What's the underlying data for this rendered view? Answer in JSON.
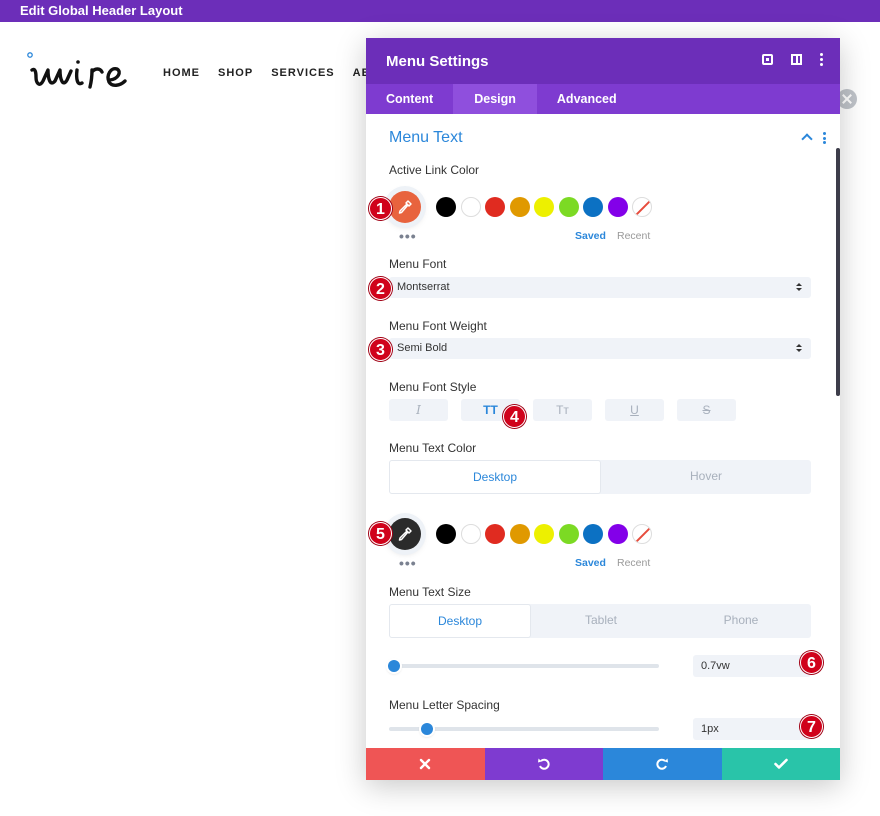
{
  "topbar": {
    "title": "Edit Global Header Layout"
  },
  "site": {
    "nav": [
      "HOME",
      "SHOP",
      "SERVICES",
      "ABO"
    ]
  },
  "modal": {
    "title": "Menu Settings",
    "tabs": [
      {
        "label": "Content",
        "active": false
      },
      {
        "label": "Design",
        "active": true
      },
      {
        "label": "Advanced",
        "active": false
      }
    ],
    "section_title": "Menu Text",
    "active_link_color": {
      "label": "Active Link Color",
      "current": "#e8633e",
      "saved_label": "Saved",
      "recent_label": "Recent"
    },
    "menu_font": {
      "label": "Menu Font",
      "value": "Montserrat"
    },
    "menu_font_weight": {
      "label": "Menu Font Weight",
      "value": "Semi Bold"
    },
    "menu_font_style": {
      "label": "Menu Font Style",
      "buttons": [
        "I",
        "TT",
        "Tт",
        "U",
        "S"
      ],
      "active_index": 1
    },
    "menu_text_color": {
      "label": "Menu Text Color",
      "tabs": [
        "Desktop",
        "Hover"
      ],
      "current": "#2b2b2b",
      "saved_label": "Saved",
      "recent_label": "Recent"
    },
    "menu_text_size": {
      "label": "Menu Text Size",
      "tabs": [
        "Desktop",
        "Tablet",
        "Phone"
      ],
      "value": "0.7vw",
      "slider_fraction": 0.02
    },
    "menu_letter_spacing": {
      "label": "Menu Letter Spacing",
      "value": "1px",
      "slider_fraction": 0.14
    },
    "swatches": [
      "#000000",
      "#ffffff",
      "#e02b20",
      "#e09900",
      "#edf000",
      "#7cda24",
      "#0c71c3",
      "#8300e9",
      "none"
    ],
    "badges": [
      "1",
      "2",
      "3",
      "4",
      "5",
      "6",
      "7"
    ]
  },
  "colors": {
    "purple": "#6c2eb9",
    "blue": "#2b87da",
    "red_badge": "#d0021b",
    "cancel": "#ef5555",
    "save": "#29c4a9"
  }
}
